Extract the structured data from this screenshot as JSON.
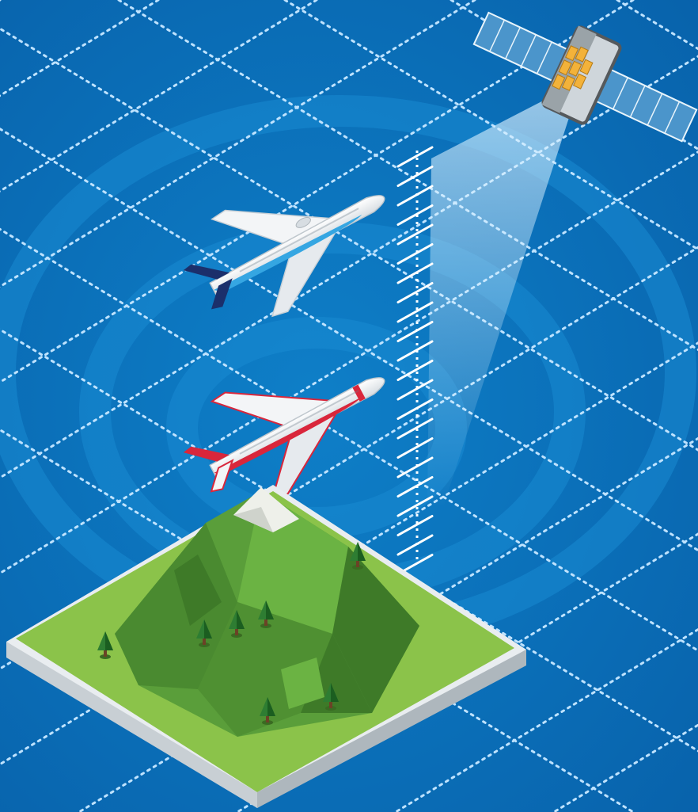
{
  "scene": {
    "background_colors": [
      "#0a6fb8",
      "#0e83cc",
      "#1392d8"
    ],
    "grid_color": "#bfe3ff",
    "satellite": {
      "icon": "satellite-icon",
      "panel_color": "#3f8fc8",
      "body_color": "#cfd6db",
      "cell_color": "#f3b23a"
    },
    "beam_color": "#bfe6ff",
    "altitude_scale": {
      "ticks": 22,
      "color": "#ffffff"
    },
    "airplanes": [
      {
        "name": "airplane-blue",
        "icon": "airplane-icon",
        "accent_color": "#1b2f6b",
        "belly_color": "#35a6e2"
      },
      {
        "name": "airplane-red",
        "icon": "airplane-icon",
        "accent_color": "#d9263b",
        "belly_color": "#d9263b"
      }
    ],
    "terrain": {
      "ground_color": "#8bc34a",
      "base_color": "#e9edf0",
      "mountain_colors": [
        "#5a9e3a",
        "#4a8a30",
        "#3e7a28",
        "#6bb343"
      ],
      "snow_color": "#eef0ea",
      "tree_icon": "pine-tree-icon",
      "tree_count": 7
    }
  }
}
